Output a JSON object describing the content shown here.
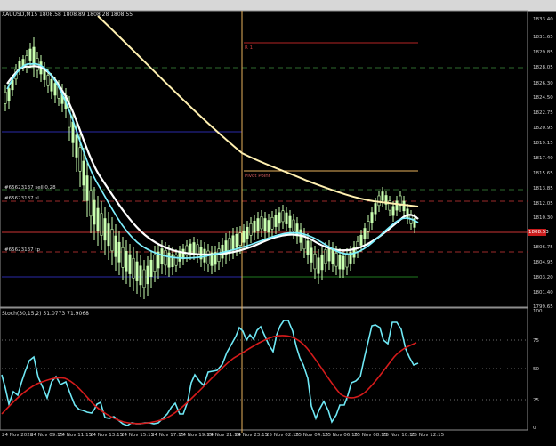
{
  "chart": {
    "title": "XAUUSD,M15  1808.58 1808.89 1808.28 1808.55",
    "current_price": "1808.53",
    "pivot_label": "Pivot Point",
    "r1_label": "R 1",
    "order_labels": [
      "#65623137 sell 0.28",
      "#65623137 sl",
      "#65623137 tp"
    ],
    "price_axis": [
      "1833.40",
      "1831.65",
      "1829.85",
      "1828.05",
      "1826.30",
      "1824.50",
      "1822.75",
      "1820.95",
      "1819.15",
      "1817.40",
      "1815.65",
      "1813.85",
      "1812.05",
      "1810.30",
      "1808.53",
      "1806.75",
      "1804.95",
      "1803.20",
      "1801.40",
      "1799.65"
    ],
    "time_axis": [
      "24 Nov 2020",
      "24 Nov 09:15",
      "24 Nov 11:15",
      "24 Nov 13:15",
      "24 Nov 15:15",
      "24 Nov 17:15",
      "24 Nov 19:15",
      "24 Nov 21:15",
      "24 Nov 23:15",
      "25 Nov 02:15",
      "25 Nov 04:15",
      "25 Nov 06:15",
      "25 Nov 08:15",
      "25 Nov 10:15",
      "25 Nov 12:15"
    ]
  },
  "stochastic": {
    "title": "Stoch(30,15,2) 51.0773 71.9068",
    "levels": [
      "100",
      "75",
      "50",
      "25",
      "0"
    ]
  },
  "colors": {
    "background": "#000000",
    "candle": "#c9ffb0",
    "ma_white": "#ffffff",
    "ma_cyan": "#7ff0ff",
    "ma_cream": "#fff0b0",
    "stoch_main": "#6fe8f5",
    "stoch_signal": "#d51b1b",
    "grid": "#2f6e2f"
  }
}
